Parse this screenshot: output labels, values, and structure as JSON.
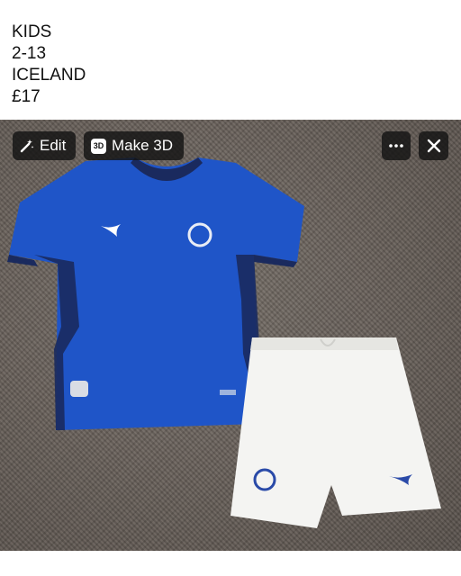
{
  "caption": {
    "lines": [
      "KIDS",
      "2-13",
      "ICELAND",
      "£17"
    ]
  },
  "toolbar": {
    "edit_label": "Edit",
    "make3d_label": "Make 3D",
    "make3d_badge": "3D",
    "edit_icon": "magic-wand-icon",
    "more_icon": "more-horizontal-icon",
    "close_icon": "close-icon"
  },
  "photo": {
    "subject": "kids football kit",
    "colors": {
      "shirt": "#1f55c8",
      "trim": "#1a2a5e",
      "shorts": "#f4f4f2",
      "carpet": "#6f6761"
    }
  }
}
